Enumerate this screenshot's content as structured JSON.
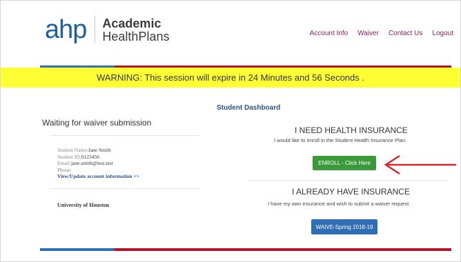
{
  "logo": {
    "mark": "ahp",
    "line1": "Academic",
    "line2": "HealthPlans"
  },
  "nav": [
    {
      "label": "Account Info"
    },
    {
      "label": "Waiver"
    },
    {
      "label": "Contact Us"
    },
    {
      "label": "Logout"
    }
  ],
  "warning": {
    "text": "WARNING: This session will expire in 24 Minutes and 56 Seconds ."
  },
  "dashboard": {
    "title": "Student Dashboard"
  },
  "left": {
    "status": "Waiting for waiver submission",
    "name_label": "Student Name:",
    "name_value": "Jane Smith",
    "id_label": "Student ID:",
    "id_value": "0123456",
    "email_label": "Email:",
    "email_value": "jane.smith@test.test",
    "phone_label": "Phone:",
    "update_link": "View/Update account information >>",
    "university": "University of Houston"
  },
  "right": {
    "need_title": "I NEED HEALTH INSURANCE",
    "need_sub": "I would like to enroll in the Student Health Insurance Plan.",
    "enroll_label": "ENROLL - Click Here",
    "have_title": "I ALREADY HAVE INSURANCE",
    "have_sub": "I have my own insurance and wish to submit a waiver request.",
    "waive_label": "WAIVE-Spring 2018-19"
  },
  "colors": {
    "accent_blue": "#2f6db5",
    "accent_red": "#b5122c",
    "warning_bg": "#ffff33",
    "enroll_green": "#3a9a3a",
    "nav_color": "#8a1f5a",
    "arrow_red": "#d7262b"
  }
}
